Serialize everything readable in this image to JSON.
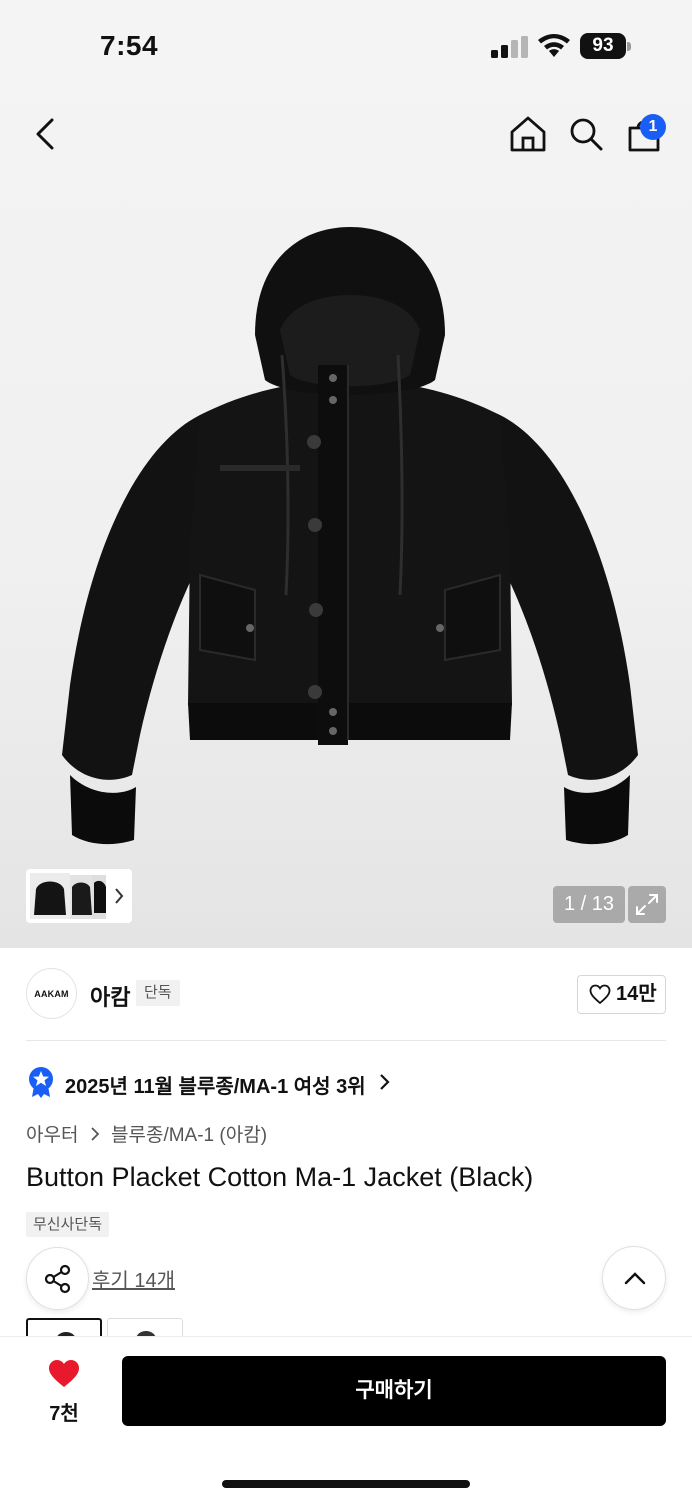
{
  "status_bar": {
    "time": "7:54",
    "battery": "93"
  },
  "nav": {
    "cart_count": "1",
    "back_icon": "chevron-left",
    "home_icon": "home",
    "search_icon": "search",
    "cart_icon": "shopping-bag"
  },
  "gallery": {
    "pager": "1 / 13"
  },
  "brand": {
    "logo_text": "AAKAM",
    "name": "아캄",
    "tag": "단독",
    "likes": "14만"
  },
  "ranking": {
    "text": "2025년 11월 블루종/MA-1 여성 3위"
  },
  "breadcrumb": {
    "category": "아우터",
    "subcategory": "블루종/MA-1 (아캄)"
  },
  "product": {
    "title": "Button Placket Cotton Ma-1 Jacket (Black)",
    "tag": "무신사단독",
    "reviews": "후기 14개"
  },
  "bottom": {
    "wish_count": "7천",
    "buy_label": "구매하기"
  },
  "colors": {
    "accent_blue": "#1a5ff5",
    "heart_red": "#e8192c",
    "buy_bg": "#000000"
  }
}
